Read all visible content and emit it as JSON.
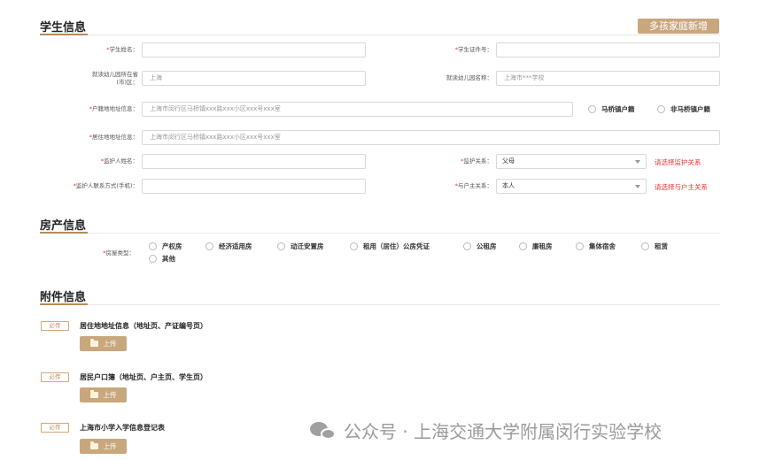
{
  "student": {
    "title": "学生信息",
    "add_button": "多孩家庭新增",
    "name_label": "*学生姓名：",
    "name_value": "",
    "id_label": "*学生证件号：",
    "id_value": "",
    "kg_district_label_1": "就读幼儿园所在省",
    "kg_district_label_2": "(市)区：",
    "kg_district_value": "上海",
    "kg_name_label": "就读幼儿园名称：",
    "kg_name_value": "上海市***学校",
    "hukou_label": "*户籍地地址信息：",
    "hukou_value": "上海市闵行区马桥镇xxx路xxx小区xxx号xxx室",
    "hukou_options": [
      "马桥镇户籍",
      "非马桥镇户籍"
    ],
    "residence_label": "*居住地地址信息：",
    "residence_value": "上海市闵行区马桥镇xxx路xxx小区xxx号xxx室",
    "guardian_name_label": "*监护人姓名：",
    "guardian_name_value": "",
    "guardian_rel_label": "*监护关系：",
    "guardian_rel_value": "父母",
    "guardian_rel_hint": "请选择监护关系",
    "guardian_phone_label": "*监护人联系方式(手机)：",
    "guardian_phone_value": "",
    "householder_rel_label": "*与户主关系：",
    "householder_rel_value": "本人",
    "householder_rel_hint": "请选择与户主关系"
  },
  "property": {
    "title": "房产信息",
    "type_label": "*房屋类型：",
    "options": [
      "产权房",
      "经济适用房",
      "动迁安置房",
      "租用（居住）公房凭证",
      "公租房",
      "廉租房",
      "集体宿舍",
      "租赁",
      "其他"
    ]
  },
  "attachments": {
    "title": "附件信息",
    "items": [
      {
        "badge": "必传",
        "title": "居住地地址信息（地址页、产证编号页）",
        "button": "上传"
      },
      {
        "badge": "必传",
        "title": "居民户口簿（地址页、户主页、学生页）",
        "button": "上传"
      },
      {
        "badge": "必传",
        "title": "上海市小学入学信息登记表",
        "button": "上传"
      }
    ]
  },
  "watermark": {
    "text": "公众号 · 上海交通大学附属闵行实验学校"
  },
  "colors": {
    "accent": "#c9a77d",
    "required": "#ee3333",
    "border": "#d9d9d9"
  }
}
